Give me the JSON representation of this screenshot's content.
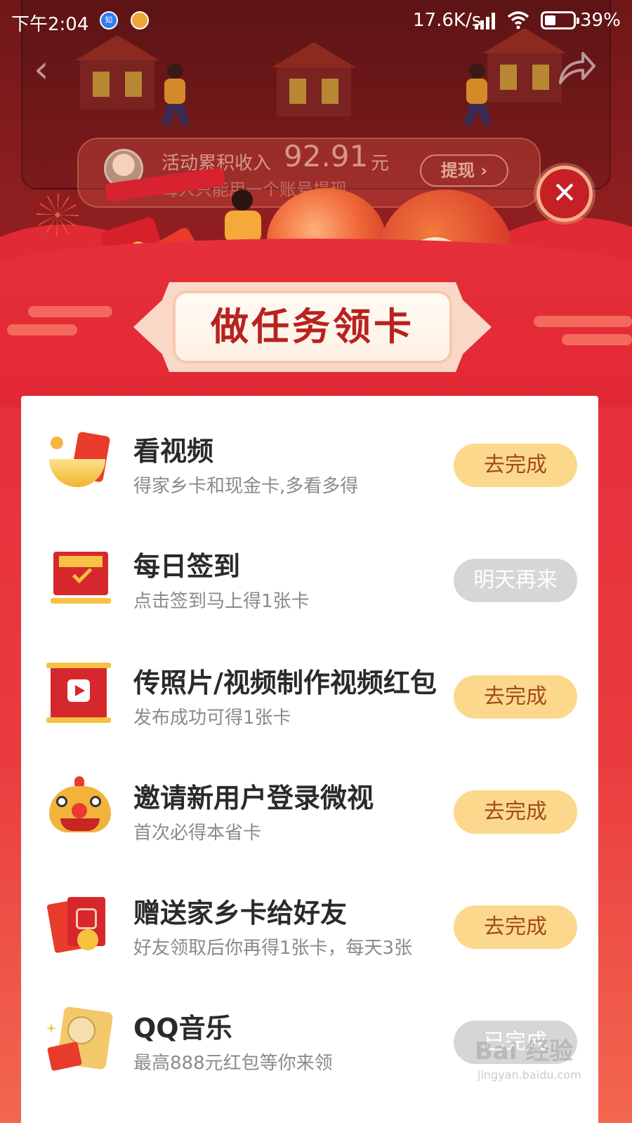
{
  "status_bar": {
    "time": "下午2:04",
    "net_speed": "17.6K/s",
    "battery": "39%",
    "battery_level": 0.39
  },
  "earnings": {
    "label": "活动累积收入",
    "amount": "92.91",
    "unit": "元",
    "note": "每人只能用一个账号提现",
    "withdraw_label": "提现 ›"
  },
  "banner": {
    "title": "做任务领卡"
  },
  "tasks": [
    {
      "title": "看视频",
      "desc": "得家乡卡和现金卡,多看多得",
      "button": "去完成",
      "state": "active",
      "icon": "video-reward-icon"
    },
    {
      "title": "每日签到",
      "desc": "点击签到马上得1张卡",
      "button": "明天再来",
      "state": "done",
      "icon": "calendar-check-icon"
    },
    {
      "title": "传照片/视频制作视频红包",
      "desc": "发布成功可得1张卡",
      "button": "去完成",
      "state": "active",
      "icon": "video-scroll-icon"
    },
    {
      "title": "邀请新用户登录微视",
      "desc": "首次必得本省卡",
      "button": "去完成",
      "state": "active",
      "icon": "lion-dance-icon"
    },
    {
      "title": "赠送家乡卡给好友",
      "desc": "好友领取后你再得1张卡，每天3张",
      "button": "去完成",
      "state": "active",
      "icon": "gift-envelope-icon"
    },
    {
      "title": "QQ音乐",
      "desc": "最高888元红包等你来领",
      "button": "已完成",
      "state": "done",
      "icon": "qq-music-mouse-icon"
    }
  ],
  "watermark": {
    "brand": "Bai 经验",
    "url": "jingyan.baidu.com"
  },
  "colors": {
    "primary_red": "#e62f3a",
    "button_active": "#fcd88c",
    "button_active_text": "#a14b1b",
    "button_done": "#d6d6d6",
    "title_red": "#b8221f"
  }
}
